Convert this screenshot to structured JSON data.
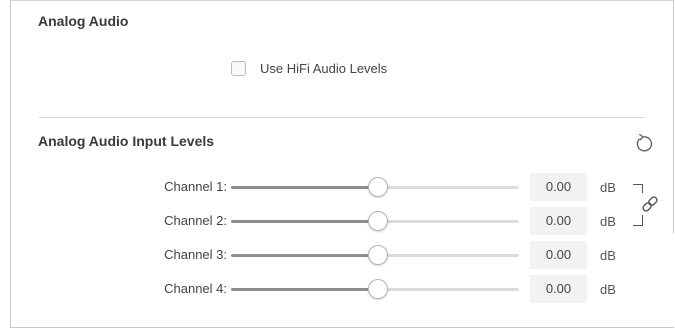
{
  "analog_audio": {
    "title": "Analog Audio",
    "hifi_checkbox": {
      "label": "Use HiFi Audio Levels",
      "checked": false
    }
  },
  "input_levels": {
    "title": "Analog Audio Input Levels",
    "reset_icon": "reset-icon",
    "link_icon": "link-icon",
    "channels": [
      {
        "label": "Channel 1:",
        "value": "0.00",
        "unit": "dB",
        "slider_level": 0.51
      },
      {
        "label": "Channel 2:",
        "value": "0.00",
        "unit": "dB",
        "slider_level": 0.51
      },
      {
        "label": "Channel 3:",
        "value": "0.00",
        "unit": "dB",
        "slider_level": 0.51
      },
      {
        "label": "Channel 4:",
        "value": "0.00",
        "unit": "dB",
        "slider_level": 0.51
      }
    ]
  },
  "colors": {
    "track_fill": "#8e8e8e",
    "track_empty": "#dcdcdc",
    "value_box_bg": "#f2f2f2"
  }
}
